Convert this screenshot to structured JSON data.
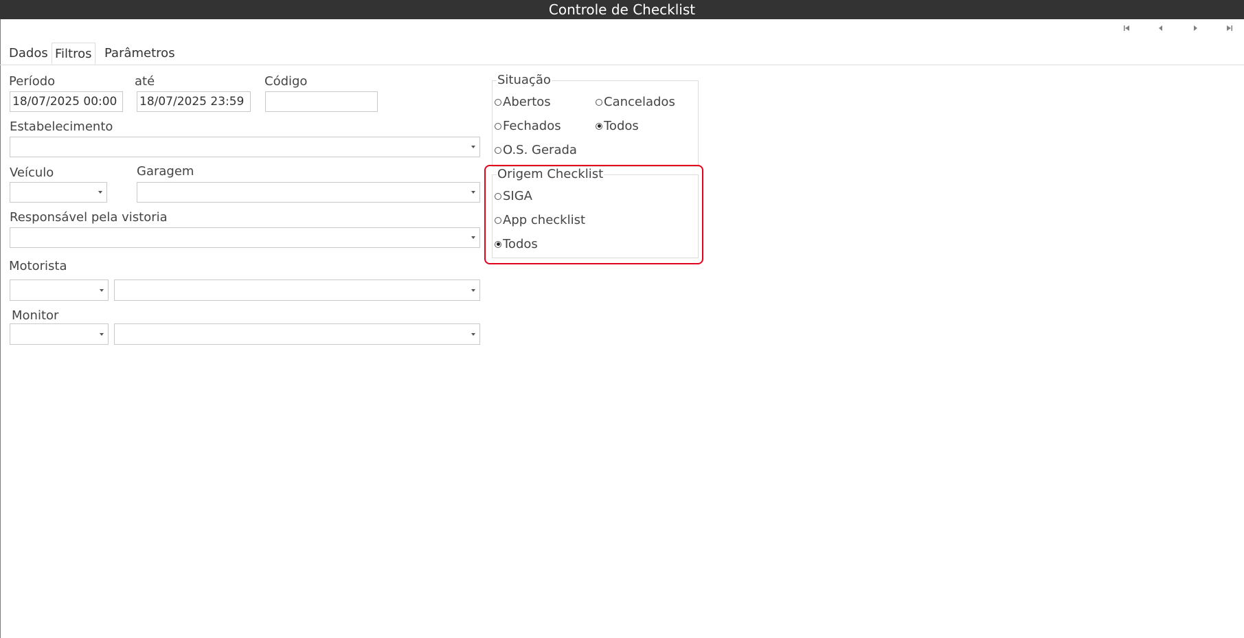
{
  "window": {
    "title": "Controle de Checklist"
  },
  "nav": {
    "first_icon": "first-record-icon",
    "prev_icon": "previous-record-icon",
    "next_icon": "next-record-icon",
    "last_icon": "last-record-icon"
  },
  "tabs": [
    {
      "label": "Dados",
      "active": false
    },
    {
      "label": "Filtros",
      "active": true
    },
    {
      "label": "Parâmetros",
      "active": false
    }
  ],
  "filters": {
    "periodo_label": "Período",
    "periodo_value": "18/07/2025 00:00",
    "ate_label": "até",
    "ate_value": "18/07/2025 23:59",
    "codigo_label": "Código",
    "codigo_value": "",
    "estabelecimento_label": "Estabelecimento",
    "veiculo_label": "Veículo",
    "garagem_label": "Garagem",
    "responsavel_label": "Responsável pela vistoria",
    "motorista_label": "Motorista",
    "monitor_label": "Monitor"
  },
  "situacao": {
    "title": "Situação",
    "options": [
      {
        "label": "Abertos",
        "checked": false
      },
      {
        "label": "Cancelados",
        "checked": false
      },
      {
        "label": "Fechados",
        "checked": false
      },
      {
        "label": "Todos",
        "checked": true
      },
      {
        "label": "O.S. Gerada",
        "checked": false
      }
    ]
  },
  "origem": {
    "title": "Origem Checklist",
    "options": [
      {
        "label": "SIGA",
        "checked": false
      },
      {
        "label": "App checklist",
        "checked": false
      },
      {
        "label": "Todos",
        "checked": true
      }
    ]
  },
  "colors": {
    "titlebar": "#333333",
    "highlight": "#e2001a"
  }
}
